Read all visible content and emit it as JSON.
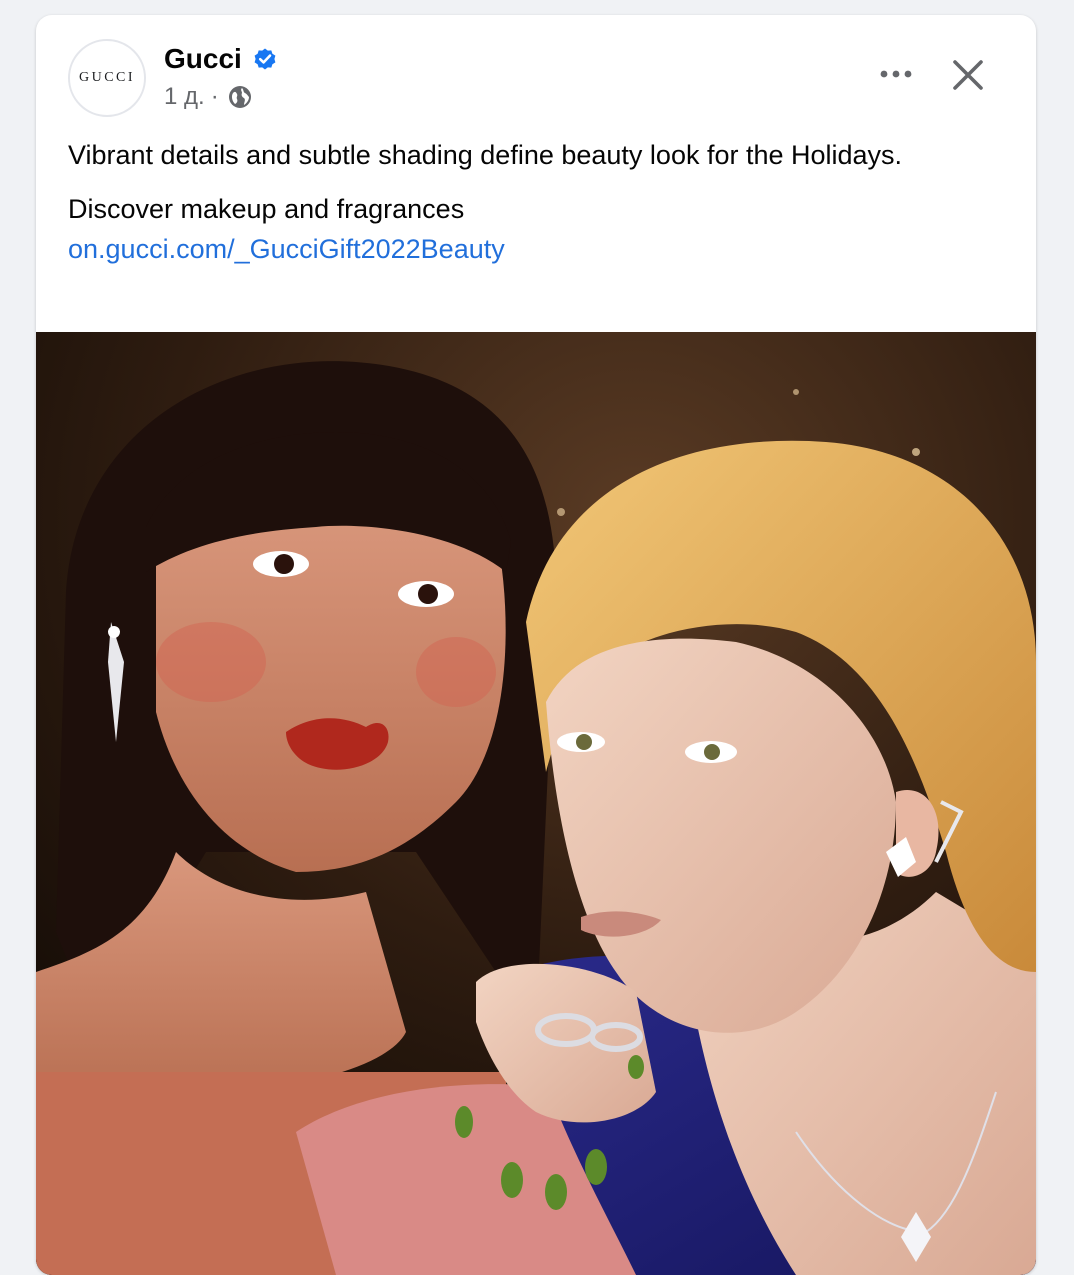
{
  "post": {
    "avatar_text": "GUCCI",
    "page_name": "Gucci",
    "verified_icon": "verified-badge-icon",
    "timestamp": "1 д.",
    "separator": "·",
    "audience_icon": "globe-icon",
    "more_icon": "more-horizontal-icon",
    "close_icon": "close-icon",
    "caption_line1": "Vibrant details and subtle shading define beauty look for the Holidays.",
    "caption_line2": "Discover makeup and fragrances",
    "caption_link": "on.gucci.com/_GucciGift2022Beauty"
  },
  "colors": {
    "background": "#f0f2f5",
    "card": "#ffffff",
    "verified_blue": "#1877f2",
    "link_blue": "#216fdb",
    "muted_text": "#65676b"
  }
}
